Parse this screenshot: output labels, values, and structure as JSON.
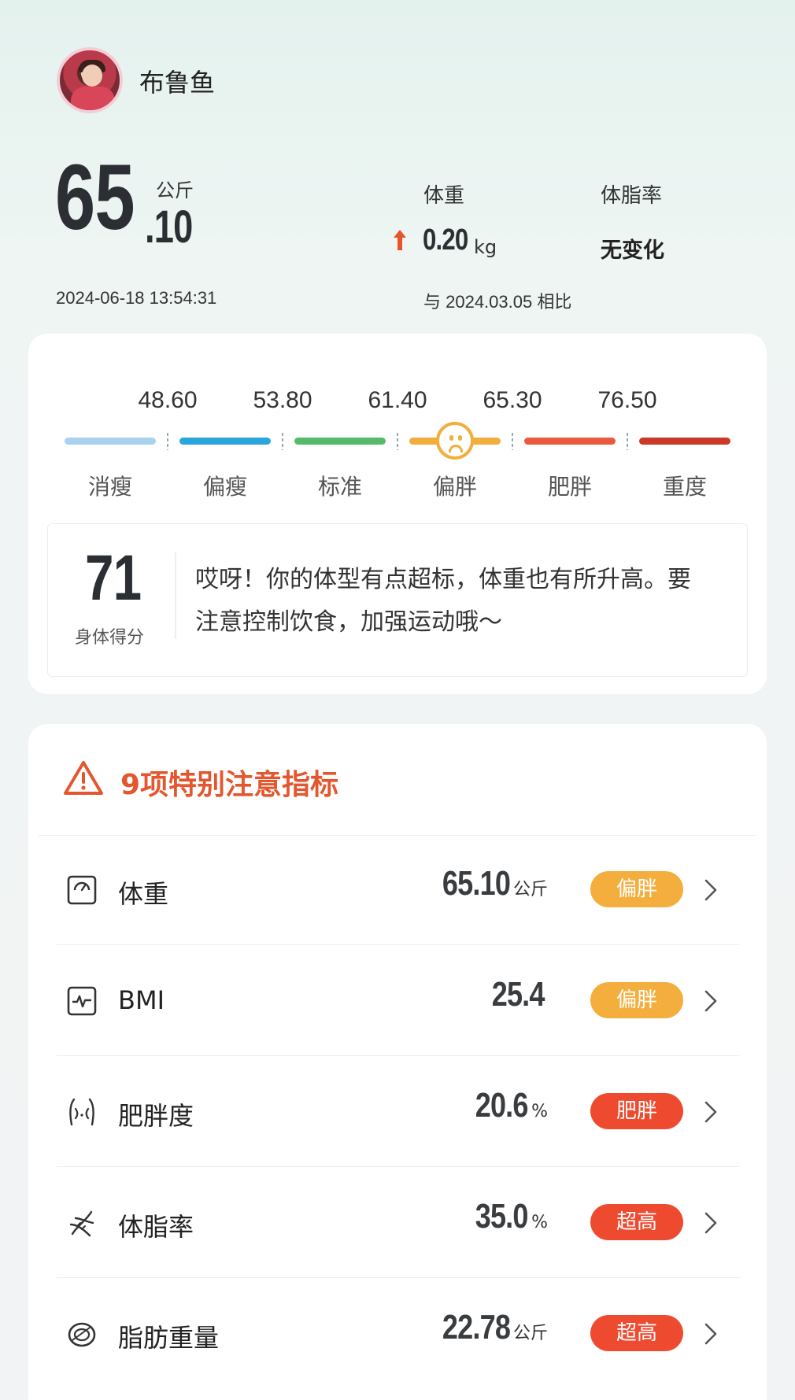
{
  "header": {
    "username": "布鲁鱼",
    "weight_int": "65",
    "weight_dec": ".10",
    "weight_unit": "公斤",
    "timestamp": "2024-06-18 13:54:31",
    "col1_label": "体重",
    "delta_value": "0.20",
    "delta_unit": "kg",
    "col2_label": "体脂率",
    "col2_value": "无变化",
    "compare_text": "与 2024.03.05 相比"
  },
  "scale": {
    "thresholds": [
      "48.60",
      "53.80",
      "61.40",
      "65.30",
      "76.50"
    ],
    "categories": [
      "消瘦",
      "偏瘦",
      "标准",
      "偏胖",
      "肥胖",
      "重度"
    ],
    "colors": [
      "#a9d2ee",
      "#2aa6dc",
      "#55bb6b",
      "#f1ae3c",
      "#ec5a3e",
      "#c93a2a"
    ],
    "current_category": "偏胖"
  },
  "score": {
    "value": "71",
    "label": "身体得分",
    "message": "哎呀！你的体型有点超标，体重也有所升高。要注意控制饮食，加强运动哦～"
  },
  "attention": {
    "title": "9项特别注意指标",
    "accent": "#e4572e",
    "items": [
      {
        "name": "体重",
        "icon": "scale-icon",
        "value": "65.10",
        "unit": "公斤",
        "badge": "偏胖",
        "badge_color": "#f4ae3d"
      },
      {
        "name": "BMI",
        "icon": "heartbeat-icon",
        "value": "25.4",
        "unit": "",
        "badge": "偏胖",
        "badge_color": "#f4ae3d"
      },
      {
        "name": "肥胖度",
        "icon": "body-icon",
        "value": "20.6",
        "unit": "%",
        "badge": "肥胖",
        "badge_color": "#ee4a2f"
      },
      {
        "name": "体脂率",
        "icon": "dna-icon",
        "value": "35.0",
        "unit": "%",
        "badge": "超高",
        "badge_color": "#ee4a2f"
      },
      {
        "name": "脂肪重量",
        "icon": "fat-icon",
        "value": "22.78",
        "unit": "公斤",
        "badge": "超高",
        "badge_color": "#ee4a2f"
      }
    ]
  }
}
